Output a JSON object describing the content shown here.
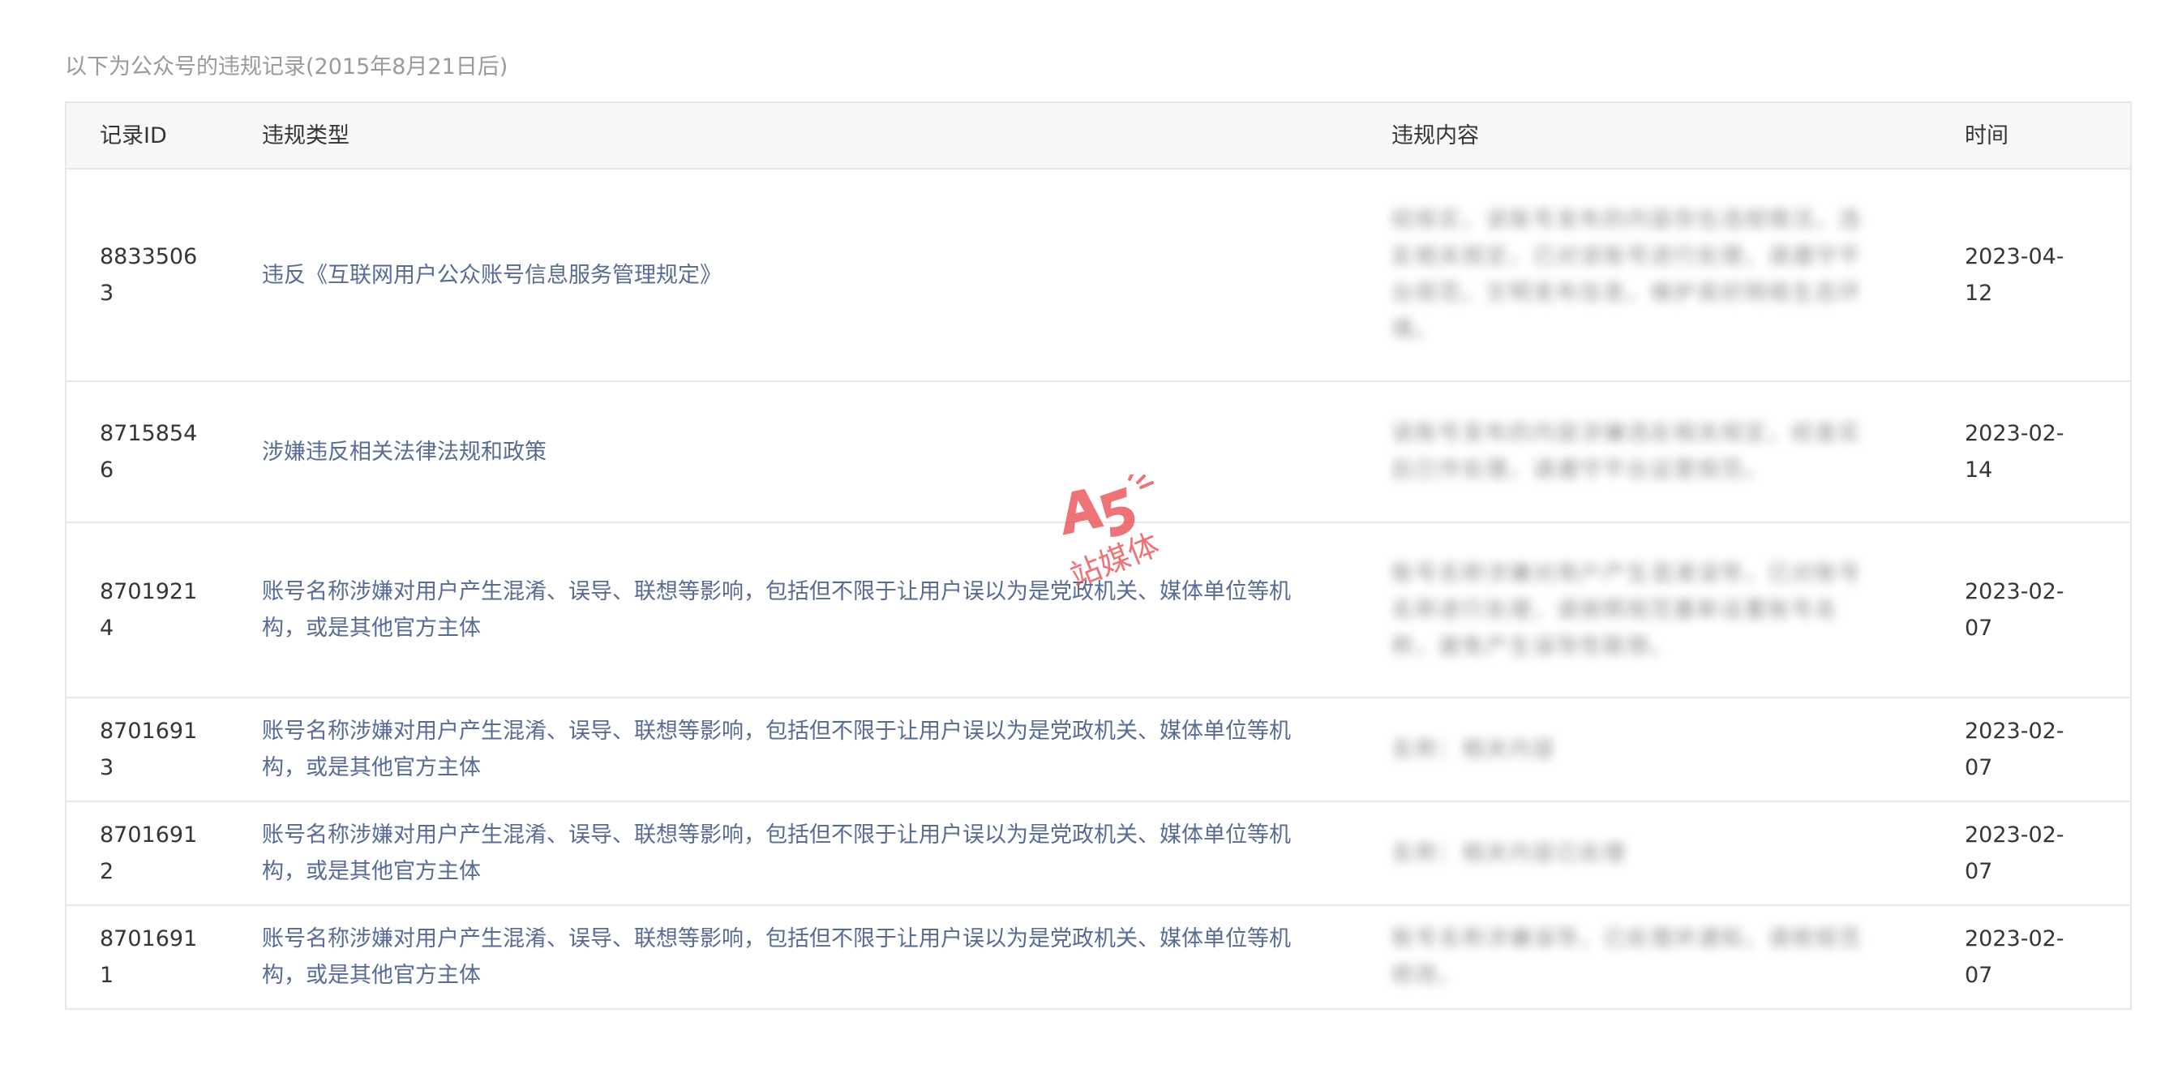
{
  "page": {
    "subtitle": "以下为公众号的违规记录(2015年8月21日后)"
  },
  "table": {
    "headers": {
      "record_id": "记录ID",
      "violation_type": "违规类型",
      "violation_content": "违规内容",
      "time": "时间"
    },
    "rows": [
      {
        "id": "88335063",
        "type": "违反《互联网用户公众账号信息服务管理规定》",
        "content": "经核实，该账号发布的内容存在违规情况，违反相关规定，已对该账号进行处理，请遵守平台规范，文明发布信息，维护良好网络生态环境。",
        "time": "2023-04-12"
      },
      {
        "id": "87158546",
        "type": "涉嫌违反相关法律法规和政策",
        "content": "该账号发布的内容涉嫌违反相关规定，经查实后已作处理，请遵守平台运营规范。",
        "time": "2023-02-14"
      },
      {
        "id": "87019214",
        "type": "账号名称涉嫌对用户产生混淆、误导、联想等影响，包括但不限于让用户误以为是党政机关、媒体单位等机构，或是其他官方主体",
        "content": "账号名称涉嫌对用户产生混淆误导，已对账号名称进行处理，请按照规范重新设置账号名称，避免产生误导性联想。",
        "time": "2023-02-07"
      },
      {
        "id": "87016913",
        "type": "账号名称涉嫌对用户产生混淆、误导、联想等影响，包括但不限于让用户误以为是党政机关、媒体单位等机构，或是其他官方主体",
        "content": "名称：相关内容",
        "time": "2023-02-07"
      },
      {
        "id": "87016912",
        "type": "账号名称涉嫌对用户产生混淆、误导、联想等影响，包括但不限于让用户误以为是党政机关、媒体单位等机构，或是其他官方主体",
        "content": "名称：相关内容已处理",
        "time": "2023-02-07"
      },
      {
        "id": "87016911",
        "type": "账号名称涉嫌对用户产生混淆、误导、联想等影响，包括但不限于让用户误以为是党政机关、媒体单位等机构，或是其他官方主体",
        "content": "账号名称涉嫌误导，已处理并通知，请按规范修改。",
        "time": "2023-02-07"
      }
    ]
  },
  "watermark": {
    "logo_text": "A5",
    "caption": "站媒体",
    "color": "#e8454a"
  },
  "colors": {
    "link": "#576b95",
    "header_bg": "#f6f7f9",
    "border": "#e7e7e7",
    "subtitle": "#9a9a9a"
  }
}
